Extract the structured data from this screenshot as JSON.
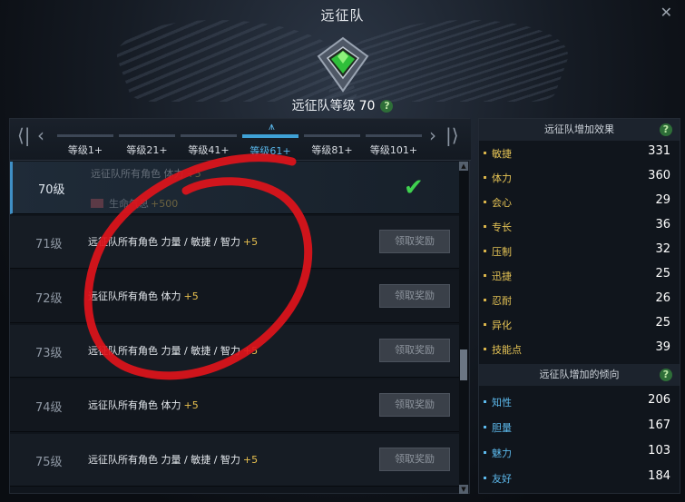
{
  "window": {
    "title": "远征队",
    "close_icon": "close-icon"
  },
  "header": {
    "level_label": "远征队等级",
    "level_value": "70",
    "help": "?"
  },
  "tabs": [
    {
      "label": "等级1+"
    },
    {
      "label": "等级21+"
    },
    {
      "label": "等级41+"
    },
    {
      "label": "等级61+",
      "active": true
    },
    {
      "label": "等级81+"
    },
    {
      "label": "等级101+"
    }
  ],
  "nav": {
    "first": "⟨|",
    "prev": "‹",
    "next": "›",
    "last": "|⟩"
  },
  "rows": [
    {
      "level": "70级",
      "desc": "远征队所有角色 体力",
      "bonus": "+5",
      "sub": "生命气息",
      "sub_bonus": "+500",
      "claimed": true
    },
    {
      "level": "71级",
      "desc": "远征队所有角色 力量 / 敏捷 / 智力",
      "bonus": "+5",
      "button": "领取奖励"
    },
    {
      "level": "72级",
      "desc": "远征队所有角色 体力",
      "bonus": "+5",
      "button": "领取奖励"
    },
    {
      "level": "73级",
      "desc": "远征队所有角色 力量 / 敏捷 / 智力",
      "bonus": "+5",
      "button": "领取奖励"
    },
    {
      "level": "74级",
      "desc": "远征队所有角色 体力",
      "bonus": "+5",
      "button": "领取奖励"
    },
    {
      "level": "75级",
      "desc": "远征队所有角色 力量 / 敏捷 / 智力",
      "bonus": "+5",
      "button": "领取奖励"
    }
  ],
  "effects": {
    "title": "远征队增加效果",
    "help": "?",
    "items": [
      {
        "name": "敏捷",
        "value": "331"
      },
      {
        "name": "体力",
        "value": "360"
      },
      {
        "name": "会心",
        "value": "29"
      },
      {
        "name": "专长",
        "value": "36"
      },
      {
        "name": "压制",
        "value": "32"
      },
      {
        "name": "迅捷",
        "value": "25"
      },
      {
        "name": "忍耐",
        "value": "26"
      },
      {
        "name": "异化",
        "value": "25"
      },
      {
        "name": "技能点",
        "value": "39"
      }
    ]
  },
  "tendencies": {
    "title": "远征队增加的倾向",
    "help": "?",
    "items": [
      {
        "name": "知性",
        "value": "206"
      },
      {
        "name": "胆量",
        "value": "167"
      },
      {
        "name": "魅力",
        "value": "103"
      },
      {
        "name": "友好",
        "value": "184"
      }
    ]
  },
  "colors": {
    "accent": "#3fa1d6",
    "gold": "#e8c04f",
    "check": "#3fd14f",
    "scribble": "#e0141b"
  }
}
